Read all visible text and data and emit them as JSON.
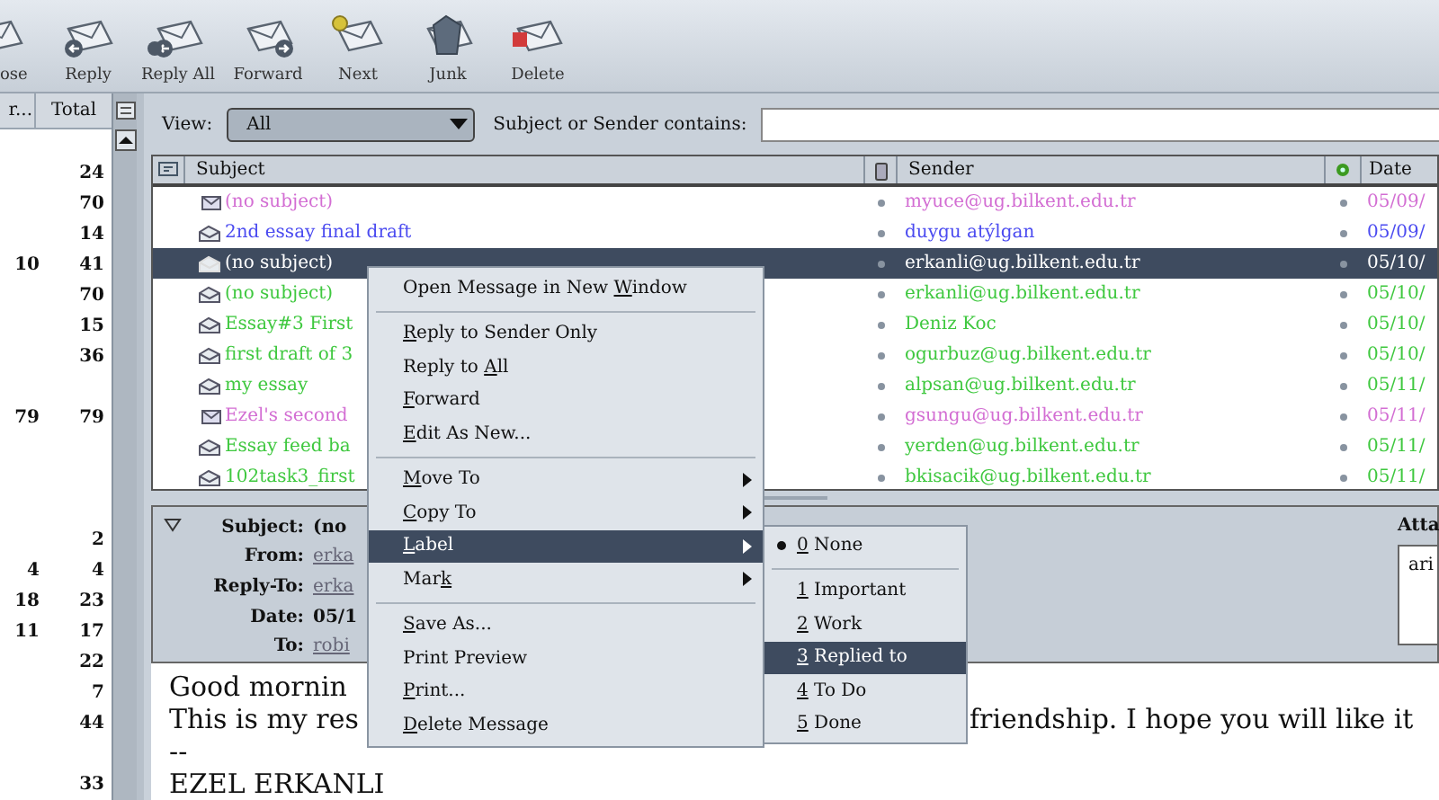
{
  "toolbar": [
    {
      "label": "ose",
      "kind": "compose"
    },
    {
      "label": "Reply",
      "kind": "reply"
    },
    {
      "label": "Reply All",
      "kind": "reply_all"
    },
    {
      "label": "Forward",
      "kind": "forward"
    },
    {
      "label": "Next",
      "kind": "next"
    },
    {
      "label": "Junk",
      "kind": "junk"
    },
    {
      "label": "Delete",
      "kind": "delete"
    }
  ],
  "folder_pane": {
    "columns": [
      "r...",
      "Total"
    ],
    "rows": [
      {
        "total": "24"
      },
      {
        "total": "70"
      },
      {
        "total": "14"
      },
      {
        "unread": "10",
        "total": "41"
      },
      {
        "total": "70"
      },
      {
        "total": "15"
      },
      {
        "total": "36"
      },
      {},
      {
        "unread": "79",
        "total": "79"
      },
      {},
      {},
      {},
      {
        "total": "2"
      },
      {
        "unread": "4",
        "total": "4"
      },
      {
        "unread": "18",
        "total": "23"
      },
      {
        "unread": "11",
        "total": "17"
      },
      {
        "total": "22"
      },
      {
        "total": "7"
      },
      {
        "total": "44"
      },
      {},
      {
        "total": "33"
      }
    ]
  },
  "filter": {
    "view_label": "View:",
    "view_value": "All",
    "search_label": "Subject or Sender contains:"
  },
  "message_list": {
    "columns": [
      "Subject",
      "Sender",
      "Date"
    ],
    "rows": [
      {
        "subject": "(no subject)",
        "sender": "myuce@ug.bilkent.edu.tr",
        "date": "05/09/",
        "color": "#d36ed3",
        "read": false,
        "selected": false
      },
      {
        "subject": "2nd essay final draft",
        "sender": "duygu atýlgan",
        "date": "05/09/",
        "color": "#4b4bf0",
        "read": true,
        "selected": false
      },
      {
        "subject": "(no subject)",
        "sender": "erkanli@ug.bilkent.edu.tr",
        "date": "05/10/",
        "read": true,
        "selected": true
      },
      {
        "subject": "(no subject)",
        "sender": "erkanli@ug.bilkent.edu.tr",
        "date": "05/10/",
        "color": "#3fc83f",
        "read": true,
        "selected": false
      },
      {
        "subject": "Essay#3 First",
        "sender": "Deniz Koc",
        "date": "05/10/",
        "color": "#3fc83f",
        "read": true,
        "selected": false
      },
      {
        "subject": "first draft of 3",
        "sender": "ogurbuz@ug.bilkent.edu.tr",
        "date": "05/10/",
        "color": "#3fc83f",
        "read": true,
        "selected": false
      },
      {
        "subject": "my essay",
        "sender": "alpsan@ug.bilkent.edu.tr",
        "date": "05/11/",
        "color": "#3fc83f",
        "read": true,
        "selected": false
      },
      {
        "subject": "Ezel's second",
        "sender": "gsungu@ug.bilkent.edu.tr",
        "date": "05/11/",
        "color": "#d36ed3",
        "read": false,
        "selected": false
      },
      {
        "subject": "Essay feed ba",
        "sender": "yerden@ug.bilkent.edu.tr",
        "date": "05/11/",
        "color": "#3fc83f",
        "read": true,
        "selected": false
      },
      {
        "subject": "102task3_first",
        "sender": "bkisacik@ug.bilkent.edu.tr",
        "date": "05/11/",
        "color": "#3fc83f",
        "read": true,
        "selected": false
      }
    ]
  },
  "headers": [
    {
      "label": "Subject:",
      "value": "(no",
      "kind": "text"
    },
    {
      "label": "From:",
      "value": "erka",
      "kind": "link"
    },
    {
      "label": "Reply-To:",
      "value": "erka",
      "kind": "link"
    },
    {
      "label": "Date:",
      "value": "05/1",
      "kind": "text"
    },
    {
      "label": "To:",
      "value": "robi",
      "kind": "link"
    }
  ],
  "attachments": {
    "label": "Atta",
    "items": [
      "ari"
    ]
  },
  "body": [
    [
      "Good mornin"
    ],
    [
      "This is my res",
      "friendship. I hope you will like it"
    ],
    [
      "--"
    ],
    [
      "EZEL ERKANLI"
    ]
  ],
  "context_menu": [
    {
      "kind": "item",
      "before": "Open Message in New ",
      "key": "W",
      "after": "indow",
      "submenu": false,
      "hovered": false
    },
    {
      "kind": "separator"
    },
    {
      "kind": "item",
      "key": "R",
      "after": "eply to Sender Only",
      "submenu": false,
      "hovered": false
    },
    {
      "kind": "item",
      "before": "Reply to ",
      "key": "A",
      "after": "ll",
      "submenu": false,
      "hovered": false
    },
    {
      "kind": "item",
      "key": "F",
      "after": "orward",
      "submenu": false,
      "hovered": false
    },
    {
      "kind": "item",
      "key": "E",
      "after": "dit As New...",
      "submenu": false,
      "hovered": false
    },
    {
      "kind": "separator"
    },
    {
      "kind": "item",
      "key": "M",
      "after": "ove To",
      "submenu": true,
      "hovered": false
    },
    {
      "kind": "item",
      "key": "C",
      "after": "opy To",
      "submenu": true,
      "hovered": false
    },
    {
      "kind": "item",
      "key": "L",
      "after": "abel",
      "submenu": true,
      "hovered": true
    },
    {
      "kind": "item",
      "before": "Mar",
      "key": "k",
      "submenu": true,
      "hovered": false
    },
    {
      "kind": "separator"
    },
    {
      "kind": "item",
      "key": "S",
      "after": "ave As...",
      "submenu": false,
      "hovered": false
    },
    {
      "kind": "item",
      "before": "Print Preview",
      "submenu": false,
      "hovered": false
    },
    {
      "kind": "item",
      "key": "P",
      "after": "rint...",
      "submenu": false,
      "hovered": false
    },
    {
      "kind": "item",
      "key": "D",
      "after": "elete Message",
      "submenu": false,
      "hovered": false
    }
  ],
  "label_submenu": [
    {
      "kind": "item",
      "key": "0",
      "after": " None",
      "selected": true,
      "hovered": false
    },
    {
      "kind": "separator"
    },
    {
      "kind": "item",
      "key": "1",
      "after": " Important",
      "selected": false,
      "hovered": false
    },
    {
      "kind": "item",
      "key": "2",
      "after": " Work",
      "selected": false,
      "hovered": false
    },
    {
      "kind": "item",
      "key": "3",
      "after": " Replied to",
      "selected": false,
      "hovered": true
    },
    {
      "kind": "item",
      "key": "4",
      "after": " To Do",
      "selected": false,
      "hovered": false
    },
    {
      "kind": "item",
      "key": "5",
      "after": " Done",
      "selected": false,
      "hovered": false
    }
  ]
}
